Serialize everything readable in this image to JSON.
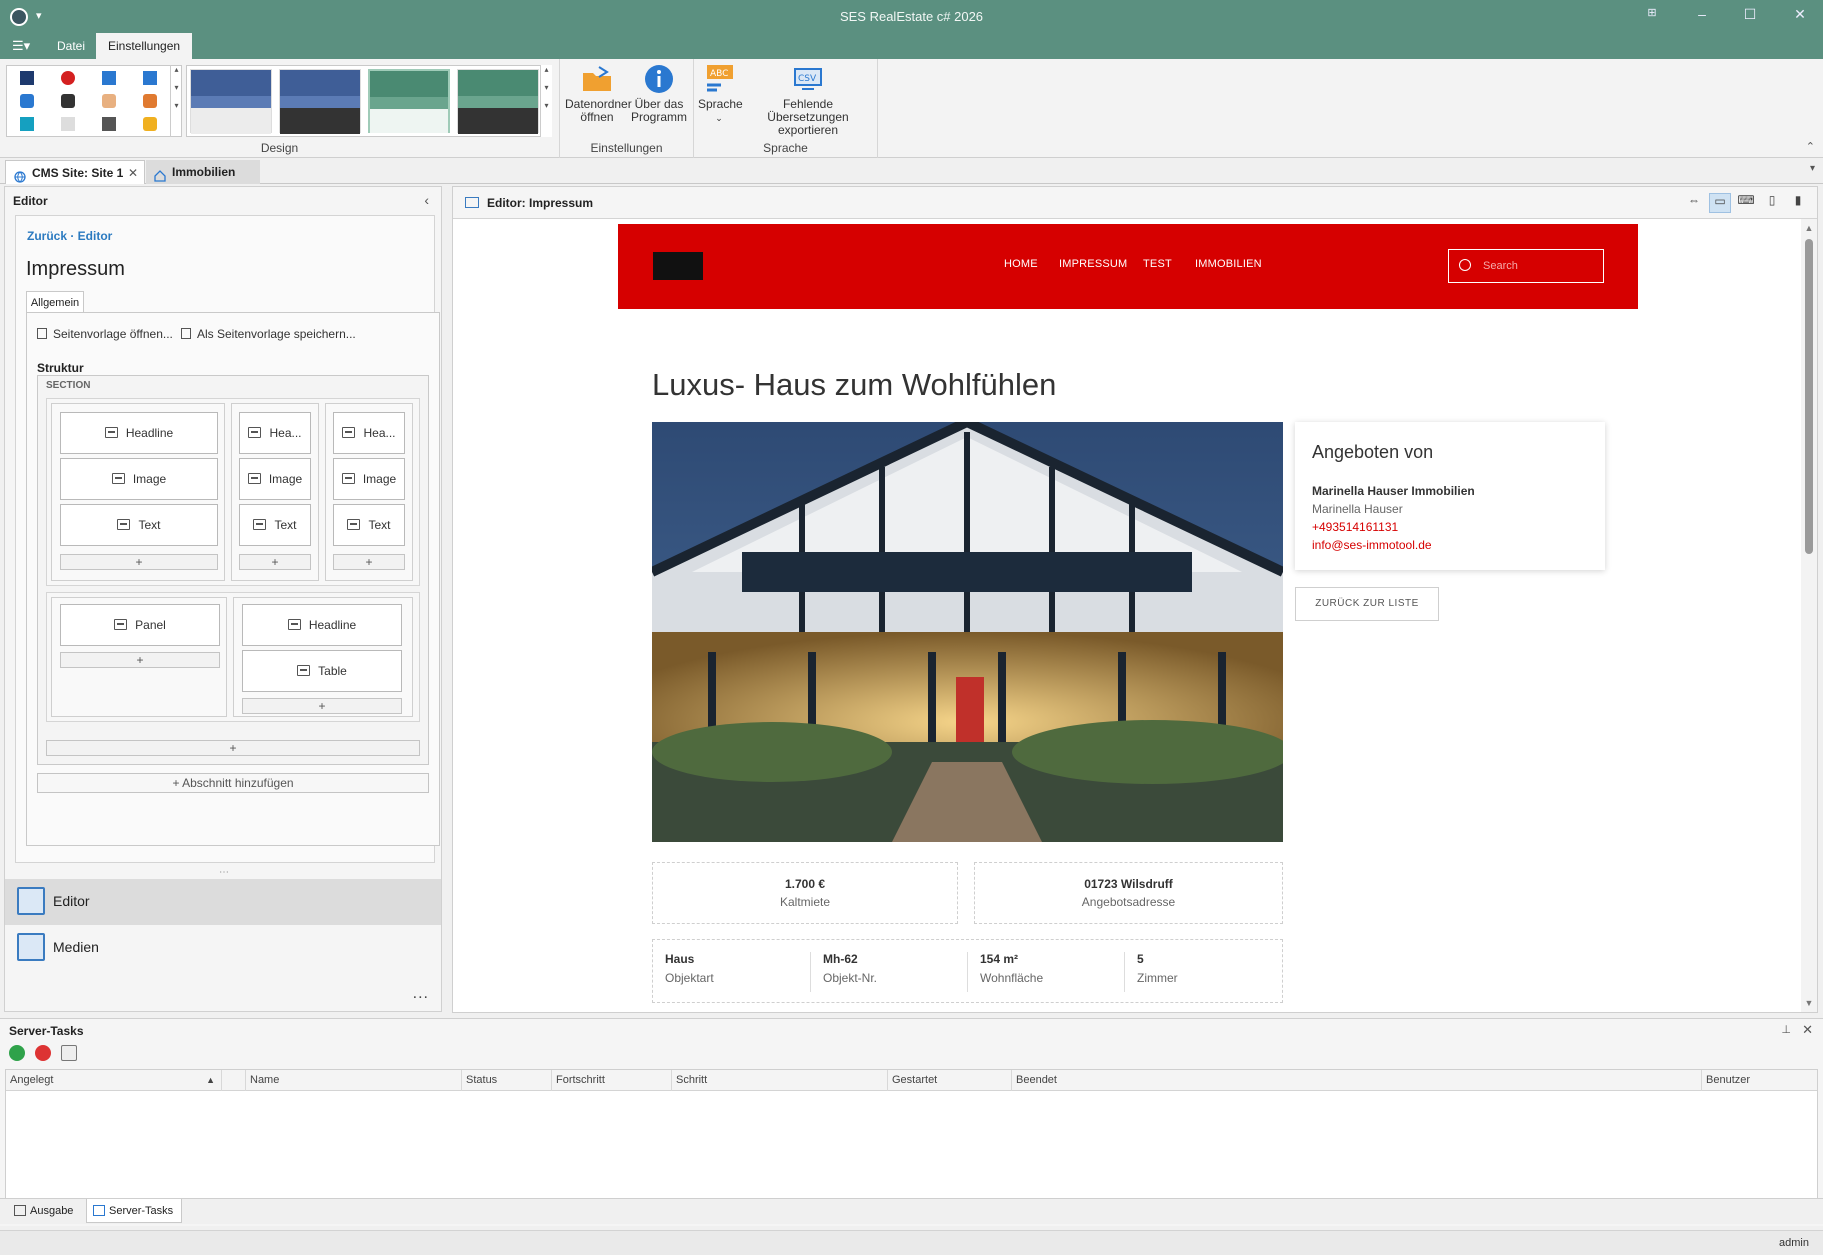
{
  "window": {
    "title": "SES RealEstate c# 2026",
    "accent_color": "#5b9080"
  },
  "ribbon": {
    "tabs": [
      "Datei",
      "Einstellungen"
    ],
    "active_tab": "Einstellungen",
    "groups": {
      "design": "Design",
      "settings": "Einstellungen",
      "language": "Sprache"
    },
    "buttons": {
      "data_folder": "Datenordner öffnen",
      "about": "Über das Programm",
      "language": "Sprache",
      "export_translations": "Fehlende Übersetzungen exportieren"
    }
  },
  "doc_tabs": {
    "cms": "CMS Site: Site 1",
    "immobilien": "Immobilien"
  },
  "left_panel": {
    "header": "Editor",
    "breadcrumb": "Zurück · Editor",
    "page_title": "Impressum",
    "tab": "Allgemein",
    "open_template": "Seitenvorlage öffnen...",
    "save_template": "Als Seitenvorlage speichern...",
    "structure_label": "Struktur",
    "section_label": "SECTION",
    "blocks": {
      "headline": "Headline",
      "headline_short": "Hea...",
      "image": "Image",
      "text": "Text",
      "panel": "Panel",
      "table": "Table"
    },
    "plus": "+",
    "add_section": "+ Abschnitt hinzufügen",
    "nav": {
      "editor": "Editor",
      "media": "Medien",
      "more": "..."
    }
  },
  "editor": {
    "title": "Editor: Impressum",
    "devices": [
      "fit-icon",
      "desktop-icon",
      "laptop-icon",
      "tablet-icon",
      "phone-icon"
    ],
    "active_device": "desktop-icon"
  },
  "site": {
    "brand_color": "#d60000",
    "nav": [
      "HOME",
      "IMPRESSUM",
      "TEST",
      "IMMOBILIEN"
    ],
    "search_placeholder": "Search",
    "title": "Luxus- Haus zum Wohlfühlen",
    "offered_by": {
      "heading": "Angeboten von",
      "company": "Marinella Hauser Immobilien",
      "person": "Marinella Hauser",
      "phone": "+493514161131",
      "email": "info@ses-immotool.de"
    },
    "back_button": "ZURÜCK ZUR LISTE",
    "facts": [
      {
        "value": "1.700 €",
        "label": "Kaltmiete"
      },
      {
        "value": "01723 Wilsdruff",
        "label": "Angebotsadresse"
      }
    ],
    "details": [
      {
        "value": "Haus",
        "label": "Objektart"
      },
      {
        "value": "Mh-62",
        "label": "Objekt-Nr."
      },
      {
        "value": "154 m²",
        "label": "Wohnfläche"
      },
      {
        "value": "5",
        "label": "Zimmer"
      }
    ]
  },
  "server_tasks": {
    "title": "Server-Tasks",
    "columns": [
      "Angelegt",
      "",
      "Name",
      "Status",
      "Fortschritt",
      "Schritt",
      "Gestartet",
      "Beendet",
      "Benutzer"
    ],
    "rows": []
  },
  "bottom_tabs": [
    "Ausgabe",
    "Server-Tasks"
  ],
  "status": {
    "user": "admin"
  }
}
